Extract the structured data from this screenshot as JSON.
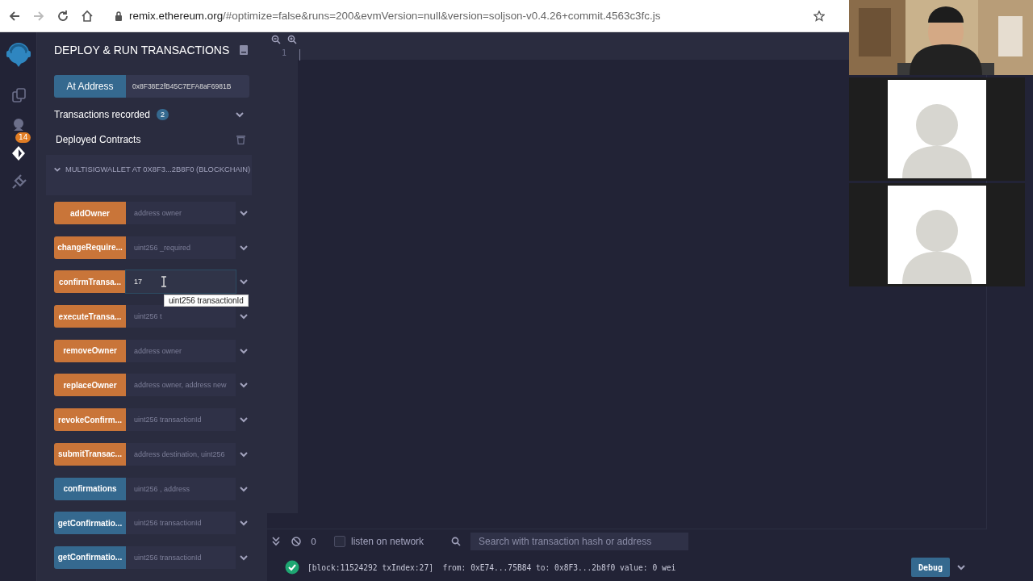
{
  "browser": {
    "url_host": "remix.ethereum.org",
    "url_path": "/#optimize=false&runs=200&evmVersion=null&version=soljson-v0.4.26+commit.4563c3fc.js"
  },
  "icon_bar": {
    "items": [
      {
        "kind": "files",
        "selected": false
      },
      {
        "kind": "compiler",
        "selected": false,
        "badge": "14"
      },
      {
        "kind": "deploy",
        "selected": true
      },
      {
        "kind": "plugins",
        "selected": false
      }
    ]
  },
  "panel": {
    "title": "DEPLOY & RUN TRANSACTIONS",
    "at_address": {
      "button": "At Address",
      "value": "0x8F38E2fB45C7EFA8aF6981B"
    },
    "transactions": {
      "label": "Transactions recorded",
      "count": "2",
      "expanded": false
    },
    "deployed": {
      "label": "Deployed Contracts"
    },
    "contract": {
      "title": "MULTISIGWALLET AT 0X8F3...2B8F0 (BLOCKCHAIN)",
      "expanded": true,
      "functions": [
        {
          "name": "addOwner",
          "kind": "transact",
          "placeholder": "address owner"
        },
        {
          "name": "changeRequire...",
          "kind": "transact",
          "placeholder": "uint256 _required"
        },
        {
          "name": "confirmTransa...",
          "kind": "transact",
          "value": "17",
          "focused": true
        },
        {
          "name": "executeTransa...",
          "kind": "transact",
          "placeholder": "uint256 t"
        },
        {
          "name": "removeOwner",
          "kind": "transact",
          "placeholder": "address owner"
        },
        {
          "name": "replaceOwner",
          "kind": "transact",
          "placeholder": "address owner, address new"
        },
        {
          "name": "revokeConfirm...",
          "kind": "transact",
          "placeholder": "uint256 transactionId"
        },
        {
          "name": "submitTransac...",
          "kind": "transact",
          "placeholder": "address destination, uint256"
        },
        {
          "name": "confirmations",
          "kind": "call",
          "placeholder": "uint256 , address"
        },
        {
          "name": "getConfirmatio...",
          "kind": "call",
          "placeholder": "uint256 transactionId"
        },
        {
          "name": "getConfirmatio...",
          "kind": "call",
          "placeholder": "uint256 transactionId"
        }
      ]
    }
  },
  "tooltip": "uint256 transactionId",
  "editor": {
    "line_numbers": [
      "1"
    ]
  },
  "terminal": {
    "count": "0",
    "listen": {
      "label": "listen on network",
      "checked": false
    },
    "search_placeholder": "Search with transaction hash or address",
    "log": {
      "succeeded": true,
      "text": "[block:11524292 txIndex:27]  from: 0xE74...75B84 to: 0x8F3...2b8f0 value: 0 wei",
      "button": "Debug"
    }
  },
  "call": {
    "tiles": [
      {
        "kind": "camera"
      },
      {
        "kind": "avatar"
      },
      {
        "kind": "avatar"
      }
    ]
  }
}
